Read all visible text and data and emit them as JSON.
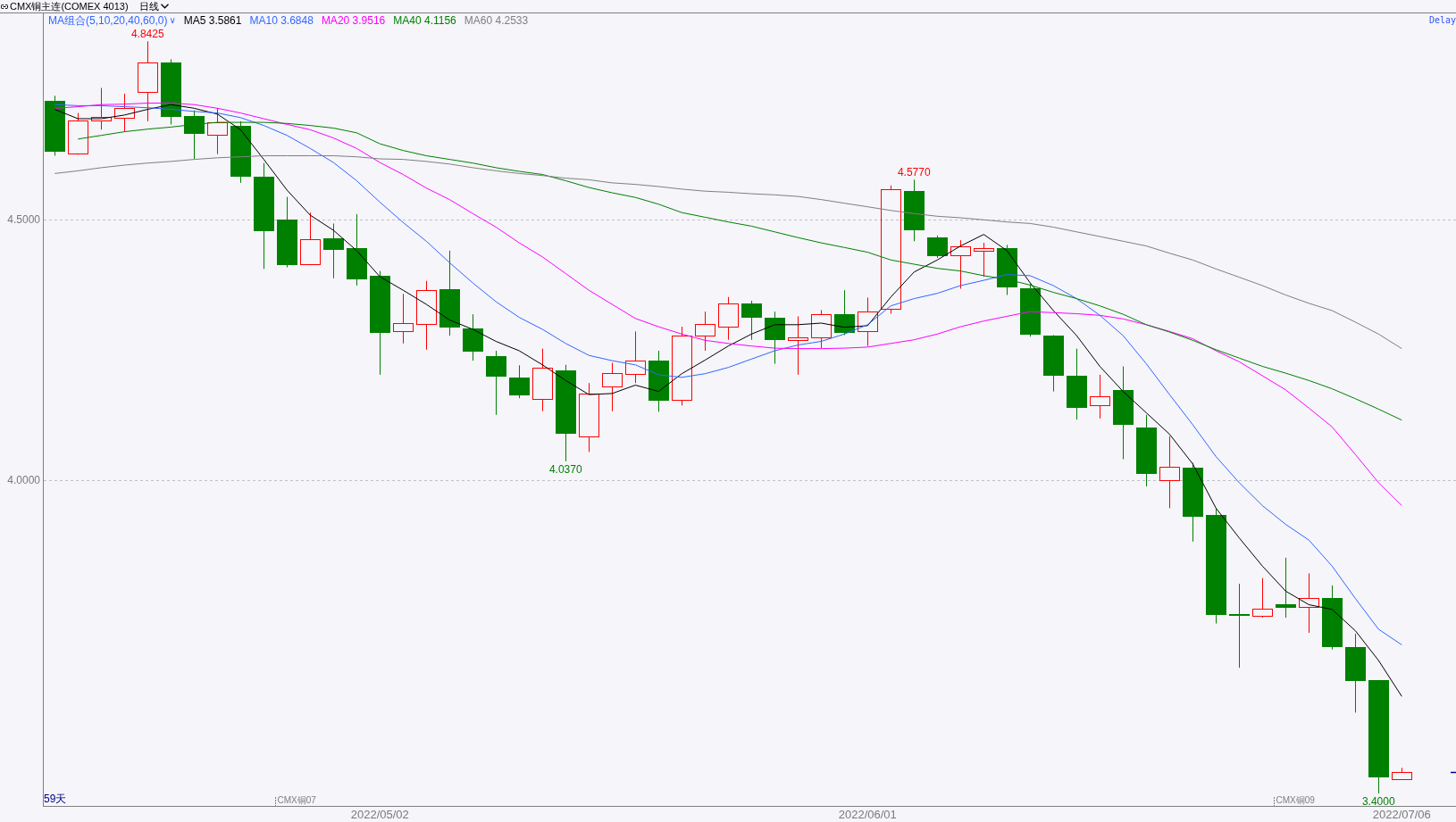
{
  "header": {
    "title": "CMX铜主连(COMEX 4013)",
    "period": "日线"
  },
  "chart": {
    "ma_group": "MA组合(5,10,20,40,60,0)",
    "ma_group_caret": "∨",
    "ma_readings": [
      "3.5861",
      "3.6848",
      "3.9516",
      "4.1156",
      "4.2533"
    ],
    "delay": "Delay",
    "bar_count": "59天",
    "contract_labels": [
      "CMX铜07",
      "CMX铜09"
    ],
    "chart_data": {
      "type": "candlestick",
      "ylim": [
        3.376,
        4.896
      ],
      "categories": [
        null,
        null,
        null,
        null,
        null,
        null,
        null,
        null,
        null,
        null,
        null,
        null,
        null,
        null,
        "2022/05/02",
        null,
        null,
        null,
        null,
        null,
        null,
        null,
        null,
        null,
        null,
        null,
        null,
        null,
        null,
        null,
        null,
        null,
        null,
        null,
        null,
        "2022/06/01",
        null,
        null,
        null,
        null,
        null,
        null,
        null,
        null,
        null,
        null,
        null,
        null,
        null,
        null,
        null,
        null,
        null,
        null,
        null,
        null,
        null,
        null,
        "2022/07/06"
      ],
      "yticks": [
        {
          "value": 4.5,
          "label": "4.5000"
        },
        {
          "value": 4.0,
          "label": "4.0000"
        }
      ],
      "ohlc": [
        [
          4.728,
          4.738,
          4.623,
          4.63
        ],
        [
          4.628,
          4.705,
          4.625,
          4.69
        ],
        [
          4.69,
          4.753,
          4.673,
          4.698
        ],
        [
          4.696,
          4.742,
          4.669,
          4.714
        ],
        [
          4.746,
          4.8425,
          4.689,
          4.801
        ],
        [
          4.801,
          4.808,
          4.683,
          4.698
        ],
        [
          4.699,
          4.71,
          4.617,
          4.665
        ],
        [
          4.664,
          4.714,
          4.626,
          4.687
        ],
        [
          4.681,
          4.689,
          4.571,
          4.582
        ],
        [
          4.582,
          4.609,
          4.406,
          4.479
        ],
        [
          4.5,
          4.544,
          4.409,
          4.413
        ],
        [
          4.415,
          4.514,
          4.413,
          4.463
        ],
        [
          4.464,
          4.493,
          4.388,
          4.443
        ],
        [
          4.445,
          4.511,
          4.374,
          4.386
        ],
        [
          4.393,
          4.402,
          4.203,
          4.283
        ],
        [
          4.286,
          4.358,
          4.263,
          4.302
        ],
        [
          4.301,
          4.383,
          4.251,
          4.365
        ],
        [
          4.367,
          4.441,
          4.278,
          4.294
        ],
        [
          4.292,
          4.319,
          4.23,
          4.247
        ],
        [
          4.238,
          4.249,
          4.126,
          4.199
        ],
        [
          4.198,
          4.221,
          4.158,
          4.164
        ],
        [
          4.157,
          4.253,
          4.133,
          4.217
        ],
        [
          4.212,
          4.222,
          4.037,
          4.089
        ],
        [
          4.085,
          4.187,
          4.055,
          4.167
        ],
        [
          4.18,
          4.226,
          4.133,
          4.206
        ],
        [
          4.205,
          4.286,
          4.187,
          4.231
        ],
        [
          4.23,
          4.249,
          4.132,
          4.153
        ],
        [
          4.155,
          4.295,
          4.144,
          4.278
        ],
        [
          4.278,
          4.324,
          4.249,
          4.301
        ],
        [
          4.295,
          4.352,
          4.27,
          4.34
        ],
        [
          4.34,
          4.345,
          4.27,
          4.313
        ],
        [
          4.313,
          4.324,
          4.224,
          4.27
        ],
        [
          4.269,
          4.315,
          4.203,
          4.274
        ],
        [
          4.274,
          4.327,
          4.254,
          4.32
        ],
        [
          4.32,
          4.365,
          4.279,
          4.283
        ],
        [
          4.286,
          4.351,
          4.258,
          4.324
        ],
        [
          4.329,
          4.566,
          4.32,
          4.559
        ],
        [
          4.555,
          4.577,
          4.459,
          4.48
        ],
        [
          4.466,
          4.47,
          4.427,
          4.431
        ],
        [
          4.432,
          4.461,
          4.368,
          4.45
        ],
        [
          4.441,
          4.456,
          4.391,
          4.445
        ],
        [
          4.445,
          4.452,
          4.356,
          4.37
        ],
        [
          4.368,
          4.377,
          4.276,
          4.279
        ],
        [
          4.278,
          4.279,
          4.171,
          4.201
        ],
        [
          4.201,
          4.253,
          4.117,
          4.139
        ],
        [
          4.144,
          4.203,
          4.119,
          4.162
        ],
        [
          4.173,
          4.219,
          4.041,
          4.107
        ],
        [
          4.101,
          4.126,
          3.989,
          4.012
        ],
        [
          4.0,
          4.085,
          3.947,
          4.027
        ],
        [
          4.025,
          4.034,
          3.883,
          3.931
        ],
        [
          3.934,
          3.947,
          3.726,
          3.742
        ],
        [
          3.744,
          3.802,
          3.641,
          3.74
        ],
        [
          3.74,
          3.813,
          3.737,
          3.754
        ],
        [
          3.763,
          3.852,
          3.737,
          3.756
        ],
        [
          3.758,
          3.822,
          3.708,
          3.774
        ],
        [
          3.774,
          3.799,
          3.676,
          3.68
        ],
        [
          3.681,
          3.706,
          3.555,
          3.616
        ],
        [
          3.617,
          3.617,
          3.4,
          3.431
        ],
        [
          3.428,
          3.449,
          3.428,
          3.441
        ]
      ],
      "series": [
        {
          "name": "MA5",
          "type": "line",
          "color": "#000000",
          "values": [
            4.712,
            4.694,
            4.694,
            4.701,
            4.712,
            4.721,
            4.714,
            4.703,
            4.673,
            4.616,
            4.557,
            4.509,
            4.48,
            4.441,
            4.391,
            4.365,
            4.338,
            4.308,
            4.29,
            4.267,
            4.249,
            4.222,
            4.192,
            4.165,
            4.167,
            4.183,
            4.171,
            4.205,
            4.231,
            4.258,
            4.281,
            4.299,
            4.299,
            4.302,
            4.294,
            4.297,
            4.352,
            4.4,
            4.423,
            4.45,
            4.472,
            4.441,
            4.379,
            4.326,
            4.278,
            4.219,
            4.171,
            4.13,
            4.089,
            4.032,
            3.947,
            3.89,
            3.836,
            3.788,
            3.762,
            3.753,
            3.712,
            3.655,
            3.586
          ]
        },
        {
          "name": "MA10",
          "type": "line",
          "color": "#3366ff",
          "values": [
            4.721,
            4.719,
            4.719,
            4.717,
            4.715,
            4.712,
            4.708,
            4.705,
            4.696,
            4.681,
            4.662,
            4.637,
            4.61,
            4.575,
            4.534,
            4.495,
            4.459,
            4.418,
            4.379,
            4.343,
            4.313,
            4.29,
            4.263,
            4.24,
            4.23,
            4.222,
            4.203,
            4.198,
            4.205,
            4.217,
            4.233,
            4.249,
            4.26,
            4.267,
            4.281,
            4.299,
            4.335,
            4.349,
            4.359,
            4.374,
            4.384,
            4.395,
            4.393,
            4.374,
            4.349,
            4.317,
            4.278,
            4.224,
            4.165,
            4.107,
            4.046,
            3.996,
            3.952,
            3.916,
            3.886,
            3.836,
            3.774,
            3.715,
            3.685
          ]
        },
        {
          "name": "MA20",
          "type": "line",
          "color": "#ff00ff",
          "values": [
            4.714,
            4.717,
            4.721,
            4.722,
            4.724,
            4.724,
            4.721,
            4.714,
            4.705,
            4.694,
            4.683,
            4.673,
            4.657,
            4.637,
            4.61,
            4.587,
            4.561,
            4.539,
            4.512,
            4.486,
            4.456,
            4.429,
            4.397,
            4.365,
            4.338,
            4.311,
            4.295,
            4.281,
            4.269,
            4.263,
            4.258,
            4.254,
            4.253,
            4.253,
            4.254,
            4.256,
            4.263,
            4.27,
            4.281,
            4.295,
            4.306,
            4.315,
            4.324,
            4.322,
            4.32,
            4.317,
            4.31,
            4.299,
            4.286,
            4.272,
            4.249,
            4.228,
            4.201,
            4.174,
            4.139,
            4.103,
            4.05,
            3.996,
            3.952
          ]
        },
        {
          "name": "MA40",
          "type": "line",
          "color": "#008000",
          "values": [
            null,
            4.655,
            4.662,
            4.669,
            4.674,
            4.678,
            4.683,
            4.687,
            4.687,
            4.687,
            4.685,
            4.681,
            4.676,
            4.667,
            4.646,
            4.633,
            4.623,
            4.616,
            4.609,
            4.6,
            4.593,
            4.587,
            4.575,
            4.562,
            4.552,
            4.543,
            4.53,
            4.514,
            4.505,
            4.496,
            4.488,
            4.477,
            4.466,
            4.456,
            4.447,
            4.438,
            4.423,
            4.415,
            4.407,
            4.402,
            4.393,
            4.386,
            4.375,
            4.361,
            4.349,
            4.335,
            4.319,
            4.299,
            4.285,
            4.269,
            4.251,
            4.235,
            4.219,
            4.206,
            4.192,
            4.176,
            4.157,
            4.137,
            4.116
          ]
        },
        {
          "name": "MA60",
          "type": "line",
          "color": "#808080",
          "values": [
            4.589,
            4.594,
            4.6,
            4.605,
            4.609,
            4.612,
            4.616,
            4.619,
            4.621,
            4.623,
            4.623,
            4.623,
            4.623,
            4.621,
            4.617,
            4.616,
            4.612,
            4.607,
            4.6,
            4.594,
            4.589,
            4.585,
            4.58,
            4.577,
            4.571,
            4.568,
            4.564,
            4.559,
            4.555,
            4.553,
            4.55,
            4.548,
            4.545,
            4.539,
            4.532,
            4.525,
            4.518,
            4.512,
            4.507,
            4.504,
            4.5,
            4.496,
            4.493,
            4.486,
            4.477,
            4.468,
            4.459,
            4.45,
            4.436,
            4.423,
            4.406,
            4.39,
            4.374,
            4.356,
            4.34,
            4.326,
            4.304,
            4.281,
            4.253
          ]
        }
      ],
      "annotations": [
        {
          "y": 4.8425,
          "text": "4.8425"
        },
        {
          "y": 4.037,
          "text": "4.0370"
        },
        {
          "y": 4.577,
          "text": "4.5770"
        },
        {
          "y": 3.4,
          "text": "3.4000"
        }
      ]
    }
  }
}
